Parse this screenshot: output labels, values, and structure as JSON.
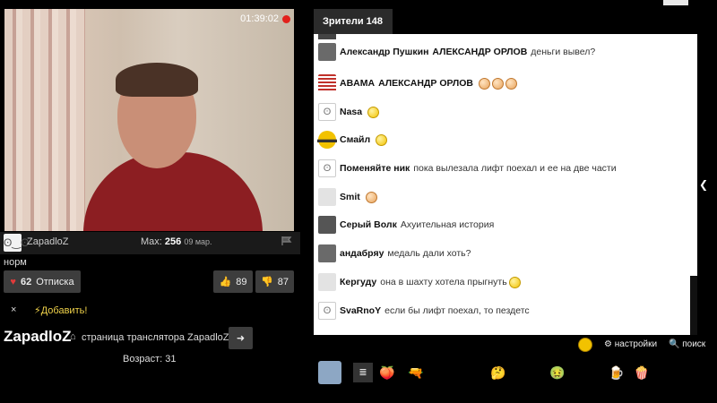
{
  "video": {
    "timer": "01:39:02"
  },
  "streamer_bar": {
    "avatar_glyph": "ʘ‿ʘ",
    "name": "ZapadloZ",
    "max_label": "Max:",
    "max_value": "256",
    "max_date": "09 мар.",
    "flag_icon": "flag-icon"
  },
  "title": "норм",
  "buttons": {
    "unsubscribe_count": "62",
    "unsubscribe_label": "Отписка",
    "like_count": "89",
    "dislike_count": "87"
  },
  "actions": {
    "close": "×",
    "add": "Добавить!"
  },
  "profile": {
    "name": "ZapadloZ",
    "page_label": "страница транслятора ZapadloZ",
    "age": "Возраст: 31"
  },
  "viewers_tab": "Зрители 148",
  "chat_messages": [
    {
      "nick": "Александр Пушкин",
      "text_bold": "АЛЕКСАНДР ОРЛОВ",
      "text": "деньги вывел?",
      "avatar": "photo",
      "emojis": []
    },
    {
      "nick": "ABAMA",
      "text_bold": "АЛЕКСАНДР ОРЛОВ",
      "text": "",
      "avatar": "us-flag",
      "emojis": [
        "peach",
        "peach",
        "peach"
      ]
    },
    {
      "nick": "Nasa",
      "text_bold": "",
      "text": "",
      "avatar": "troll-face",
      "emojis": [
        "yellow"
      ]
    },
    {
      "nick": "Смайл",
      "text_bold": "",
      "text": "",
      "avatar": "sunglasses-smiley",
      "emojis": [
        "yellow"
      ]
    },
    {
      "nick": "Поменяйте ник",
      "text_bold": "",
      "text": "пока вылезала лифт поехал и ее на две части",
      "avatar": "troll-face",
      "emojis": []
    },
    {
      "nick": "Smit",
      "text_bold": "",
      "text": "",
      "avatar": "blank",
      "emojis": [
        "peach"
      ]
    },
    {
      "nick": "Серый Волк",
      "text_bold": "",
      "text": "Ахуительная история",
      "avatar": "wolf",
      "emojis": []
    },
    {
      "nick": "андабряу",
      "text_bold": "",
      "text": "медаль дали хоть?",
      "avatar": "photo",
      "emojis": []
    },
    {
      "nick": "Кергуду",
      "text_bold": "",
      "text": "она в шахту хотела прыгнуть",
      "avatar": "blank",
      "emojis": [
        "yellow"
      ]
    },
    {
      "nick": "SvaRnoY",
      "text_bold": "",
      "text": "если бы лифт поехал, то пездетс",
      "avatar": "troll-face",
      "emojis": []
    }
  ],
  "chat_controls": {
    "settings": "настройки",
    "search": "поиск"
  },
  "emoji_bar": [
    "peach-icon",
    "gun-icon",
    "smiley-a-icon",
    "smiley-b-icon",
    "thinking-icon",
    "smiley-c-icon",
    "sick-icon",
    "kiss-icon",
    "drink-icon",
    "popcorn-icon"
  ]
}
